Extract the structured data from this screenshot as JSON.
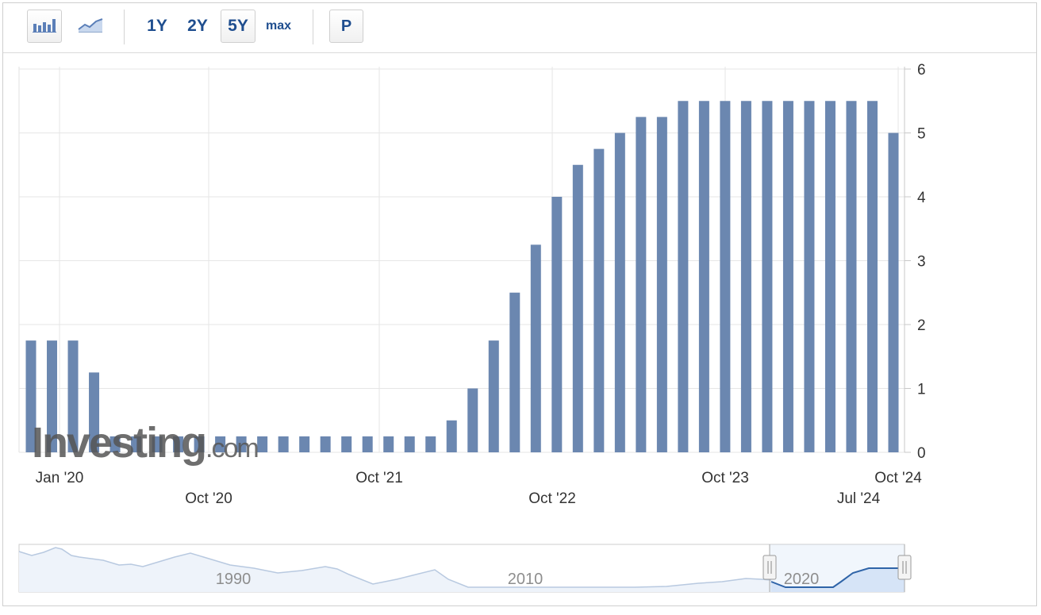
{
  "toolbar": {
    "icons": [
      "bar-chart-icon",
      "line-chart-icon"
    ],
    "ranges": [
      "1Y",
      "2Y",
      "5Y",
      "max"
    ],
    "selected_range": "5Y",
    "extra_button": "P"
  },
  "watermark": {
    "brand": "Investing",
    "suffix": ".com"
  },
  "navigator": {
    "year_labels": [
      "1990",
      "2010",
      "2020"
    ]
  },
  "colors": {
    "bar": "#6b87b0",
    "grid": "#e6e6e6",
    "accent": "#1f4e8f",
    "navigator_fill": "#d6e4f7",
    "navigator_line": "#2f64a8"
  },
  "chart_data": {
    "type": "bar",
    "title": "",
    "xlabel": "",
    "ylabel": "",
    "ylim": [
      0,
      6
    ],
    "y_ticks": [
      "0",
      "1",
      "2",
      "3",
      "4",
      "5",
      "6"
    ],
    "x_ticks_top": [
      "Jan '20",
      "Oct '21",
      "Oct '23",
      "Oct '24"
    ],
    "x_ticks_bottom": [
      "Oct '20",
      "Oct '22",
      "Jul '24"
    ],
    "grid": true,
    "y_axis_position": "right",
    "values": [
      1.75,
      1.75,
      1.75,
      1.25,
      0.25,
      0.25,
      0.25,
      0.25,
      0.25,
      0.25,
      0.25,
      0.25,
      0.25,
      0.25,
      0.25,
      0.25,
      0.25,
      0.25,
      0.25,
      0.25,
      0.5,
      1.0,
      1.75,
      2.5,
      3.25,
      4.0,
      4.5,
      4.75,
      5.0,
      5.25,
      5.25,
      5.5,
      5.5,
      5.5,
      5.5,
      5.5,
      5.5,
      5.5,
      5.5,
      5.5,
      5.5,
      5.0
    ]
  }
}
